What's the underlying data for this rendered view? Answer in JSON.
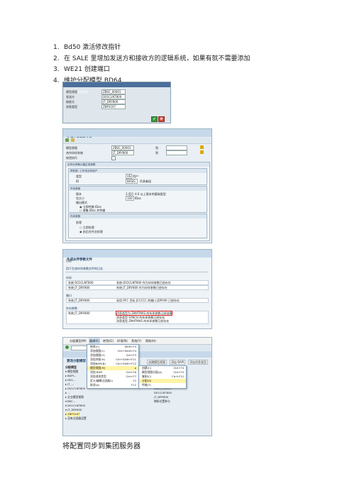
{
  "steps": [
    {
      "num": "1.",
      "text": "Bd50 激活修改指针"
    },
    {
      "num": "2.",
      "text": "在 SALE 里增加发送方和接收方的逻辑系统，如果有就不需要添加"
    },
    {
      "num": "3.",
      "text": "WE21  创建端口"
    },
    {
      "num": "4.",
      "text": "维护分配模型  BD64"
    }
  ],
  "shot1": {
    "title": "BD: 添加消息类型",
    "labels": [
      "模型视图",
      "发送方",
      "接收方",
      "消息类型"
    ],
    "values": [
      "ZBSC_00001",
      "D01CLNT800",
      "JT_DRY800",
      "ZBP3167"
    ]
  },
  "shot2": {
    "title": "生成伙伴参数文件",
    "labels": [
      "模型视图",
      "合作伙伴系统",
      "校验执行"
    ],
    "values": [
      "ZBSC_00001",
      "JT_DRY800",
      ""
    ],
    "to_label": "到",
    "group1": "合作伙伴默认值生成参数",
    "sub1": "预先配: 工作流业务用户",
    "type_label": "类型",
    "type_value": "US",
    "type_text": "用户",
    "id_label": "ID",
    "id_value": "BASIS",
    "id_text": "负责者组",
    "group2": "外向参数",
    "version_label": "版本",
    "version_text": "3 用于 4.0 以上版本的基础类型",
    "packsize_label": "包大小",
    "packsize_value": "100",
    "packsize_unit": "IDoc",
    "mode_label": "输出模式",
    "mode_opt1": "立即传输 IDoc",
    "mode_opt2": "收集 IDoc 并传输",
    "group3": "内向参数",
    "proc_label": "处理",
    "proc_opt1": "立即处理",
    "proc_opt2": "由后台作业处理"
  },
  "shot3": {
    "title": "生成伙伴参数文件",
    "log": "日志",
    "header": "用于生成伙伴参数文件的日志",
    "sec1": "伙伴",
    "rows1": [
      {
        "sys": "系统 D01CLNT800",
        "text": "系统 D01CLNT800 作为伙伴参数已经存在"
      },
      {
        "sys": "系统 JT_DRY800",
        "text": "系统 JT_DRY800 作为伙伴参数已经存在"
      }
    ],
    "sec2": "端口",
    "rows2": [
      {
        "sys": "系统 JT_DRY800",
        "text": "采用 RFC 目标 JCCCCC 的端口 JDRY00 已经存在"
      }
    ],
    "sec3": "外向参数",
    "rows3": [
      {
        "sys": "系统 JT_DRY800",
        "text": "消息类型为 ZMATMAS 的伙伴参数已经创建"
      },
      {
        "sys": "",
        "text": "消息类型 SYNCH 的伙伴参数已经存在"
      },
      {
        "sys": "",
        "text": "消息类型 ZMATMAS 的伙伴参数已经存在"
      }
    ]
  },
  "shot4": {
    "menubar": [
      "分配模型(M)",
      "编辑(E)",
      "转到(G)",
      "环境(N)",
      "系统(Y)",
      "帮助(H)"
    ],
    "title": "更改分配模型",
    "col1": "分配模型",
    "col2": "描述/技术名称",
    "tree": [
      "▾ 模型视图",
      "  ▸ BAPI…",
      "  ▸ D01…",
      "  ▸ JT_…",
      "  ▸ D01CLNT800",
      "  ▸ …",
      "  ▸ 企业模型视图",
      "  ▾ BSC…",
      "    ▾ D01CLNT800",
      "      ▾ JT_DRY800",
      "        ▸ ZBP3167",
      "          ▸ 没有过滤器设置"
    ],
    "col2vals": [
      "",
      "",
      "",
      "",
      "JSB_ZCHANGE",
      "008_PLM",
      "008_PLM",
      "INAVEPDBATE",
      "ZBSC_00001",
      "D01CLNT800",
      "JT_DRY800",
      "物料位置参与",
      "没有过滤器设置"
    ],
    "menu1": [
      {
        "label": "修改(C)",
        "sc": "Shift+F4"
      },
      {
        "label": "添加视图(1)",
        "sc": "Ctrl+Shift+F4"
      },
      {
        "label": "添加视图(V)",
        "sc": "Ctrl+F3"
      },
      {
        "label": "添加关联(H)",
        "sc": "Ctrl+Shift+F11"
      },
      {
        "label": "添加BAPI(B)",
        "sc": "Ctrl+Shift+F12"
      },
      {
        "label": "模型视图(M)",
        "sc": "▸"
      },
      {
        "label": "添加 BAPI",
        "sc": "Ctrl+F6"
      },
      {
        "label": "添加消息类型",
        "sc": "Ctrl+F7"
      },
      {
        "label": "定义/编辑过滤器(I)",
        "sc": "F2"
      },
      {
        "label": "取消(A)",
        "sc": "F12"
      }
    ],
    "menu2": [
      {
        "label": "创建(C)",
        "sc": "Ctrl+F4"
      },
      {
        "label": "模型视图分配(A)",
        "sc": "Ctrl+F5"
      },
      {
        "label": "复制(C)",
        "sc": "Ctrl+F12"
      },
      {
        "label": "分配(D)",
        "sc": ""
      },
      {
        "label": "传输(T)",
        "sc": ""
      }
    ],
    "toolbar_buttons": [
      "创建模型视图",
      "添加 BAPI",
      "添加消息类型"
    ]
  },
  "caption": "将配置同步到集团服务器"
}
